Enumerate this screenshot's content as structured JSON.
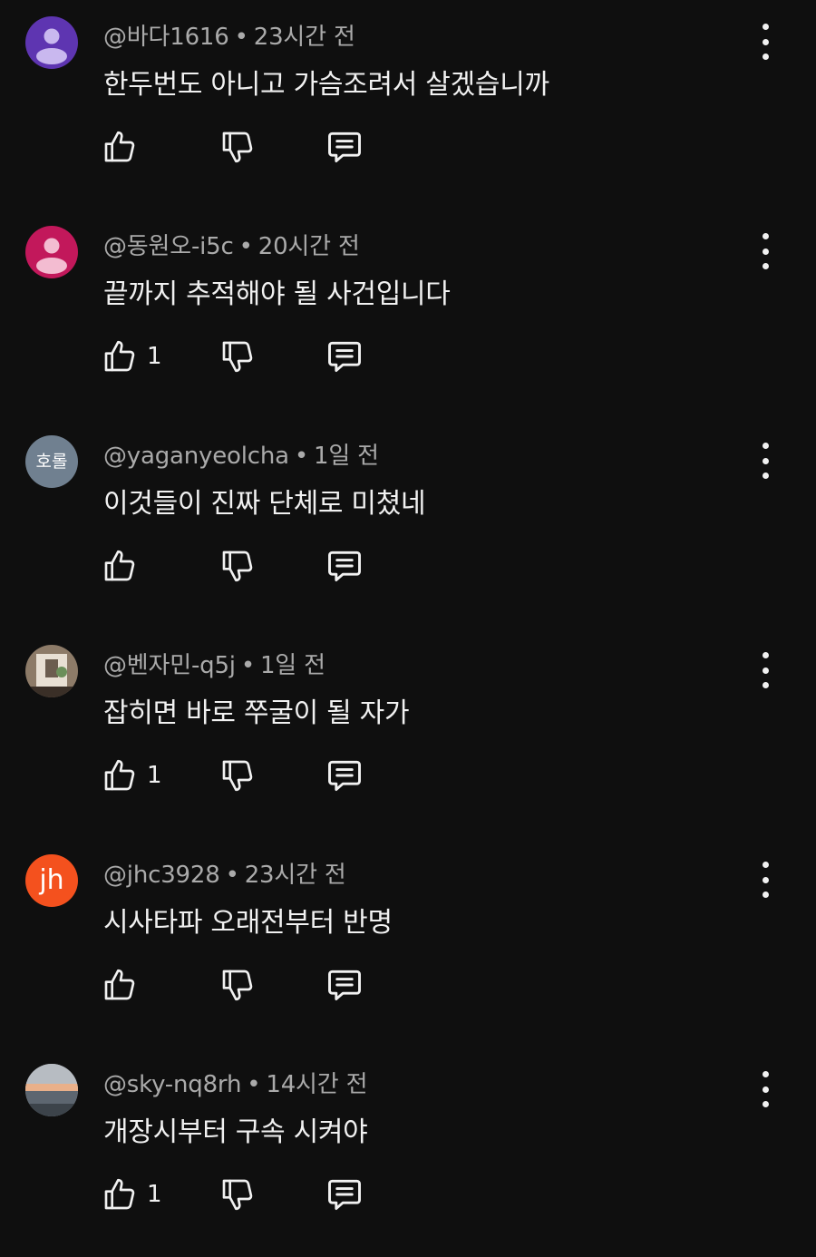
{
  "comments": [
    {
      "handle": "@바다1616",
      "separator": "•",
      "time": "23시간 전",
      "text": "한두번도 아니고 가슴조려서 살겠습니까",
      "likes": "",
      "avatar": {
        "type": "default-person",
        "bg": "#5e35b1",
        "fg": "#c9b8ef",
        "text": ""
      }
    },
    {
      "handle": "@동원오-i5c",
      "separator": "•",
      "time": "20시간 전",
      "text": "끝까지 추적해야 될 사건입니다",
      "likes": "1",
      "avatar": {
        "type": "default-person",
        "bg": "#c2185b",
        "fg": "#f3bcd1",
        "text": ""
      }
    },
    {
      "handle": "@yaganyeolcha",
      "separator": "•",
      "time": "1일 전",
      "text": "이것들이 진짜 단체로 미쳤네",
      "likes": "",
      "avatar": {
        "type": "text",
        "bg": "#708090",
        "fg": "#ffffff",
        "text": "호롤"
      }
    },
    {
      "handle": "@벤자민-q5j",
      "separator": "•",
      "time": "1일 전",
      "text": "잡히면 바로 쭈굴이 될 자가",
      "likes": "1",
      "avatar": {
        "type": "photo-room",
        "bg": "#8d7b68",
        "fg": "#e8e0d4",
        "text": ""
      }
    },
    {
      "handle": "@jhc3928",
      "separator": "•",
      "time": "23시간 전",
      "text": "시사타파 오래전부터 반명",
      "likes": "",
      "avatar": {
        "type": "text",
        "bg": "#f4511e",
        "fg": "#ffffff",
        "text": "jh"
      }
    },
    {
      "handle": "@sky-nq8rh",
      "separator": "•",
      "time": "14시간 전",
      "text": "개장시부터 구속 시켜야",
      "likes": "1",
      "avatar": {
        "type": "photo-sunset",
        "bg": "#9aa3ad",
        "fg": "#e9b08a",
        "text": ""
      }
    }
  ],
  "icons": {
    "like": "thumbs-up-icon",
    "dislike": "thumbs-down-icon",
    "reply": "reply-icon",
    "menu": "more-vert-icon"
  },
  "colors": {
    "background": "#0f0f0f",
    "primary_text": "#f1f1f1",
    "secondary_text": "#aaaaaa"
  }
}
